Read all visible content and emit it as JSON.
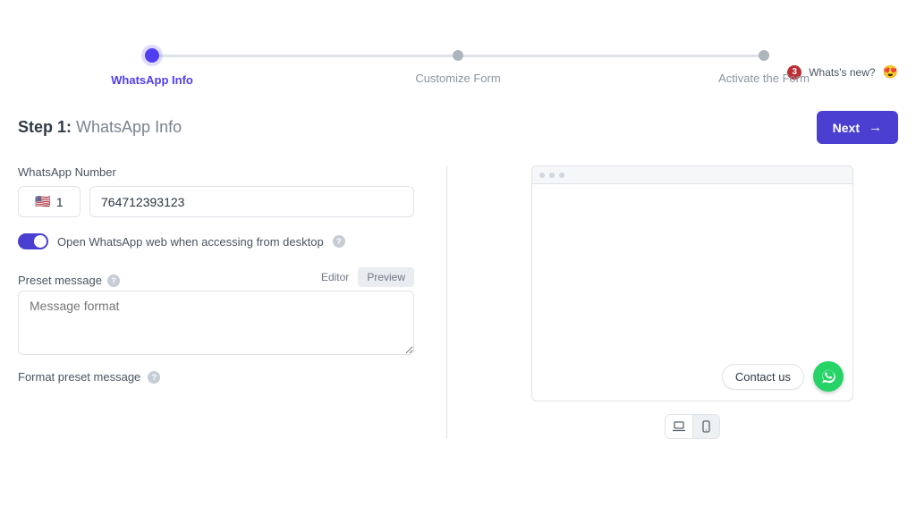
{
  "top": {
    "badge_count": "3",
    "whats_new_label": "Whats's new?",
    "emoji": "😍"
  },
  "stepper": {
    "step1": "WhatsApp Info",
    "step2": "Customize Form",
    "step3": "Activate the Form"
  },
  "title": {
    "step": "Step 1:",
    "name": "WhatsApp Info"
  },
  "next_button": "Next",
  "form": {
    "number_label": "WhatsApp Number",
    "country_flag": "🇺🇸",
    "country_code": "1",
    "phone_value": "764712393123",
    "toggle_label": "Open WhatsApp web when accessing from desktop",
    "preset_label": "Preset message",
    "editor_tab": "Editor",
    "preview_tab": "Preview",
    "preset_placeholder": "Message format",
    "format_hint": "Format preset message"
  },
  "preview": {
    "contact_label": "Contact us"
  },
  "help_char": "?"
}
